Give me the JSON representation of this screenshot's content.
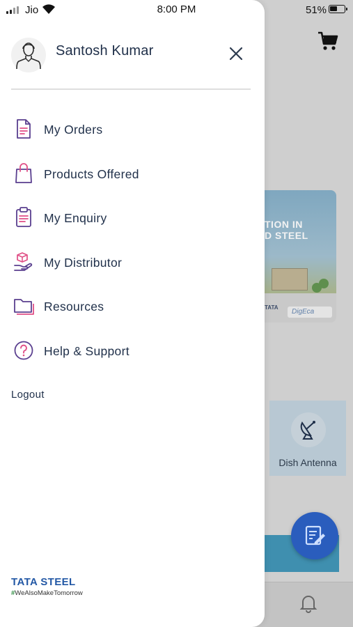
{
  "status_bar": {
    "carrier": "Jio",
    "time": "8:00 PM",
    "battery_percent": "51%",
    "battery_level": 0.51
  },
  "background": {
    "banner_lines": [
      "TION IN",
      "D STEEL"
    ],
    "banner_tata": "TATA",
    "banner_brand": "DigEca",
    "card_label": "Dish Antenna"
  },
  "drawer": {
    "user_name": "Santosh Kumar",
    "close_icon": "close-icon",
    "menu_items": [
      {
        "label": "My Orders",
        "icon": "document-icon"
      },
      {
        "label": "Products Offered",
        "icon": "shopping-bag-icon"
      },
      {
        "label": "My Enquiry",
        "icon": "clipboard-icon"
      },
      {
        "label": "My Distributor",
        "icon": "hand-package-icon"
      },
      {
        "label": "Resources",
        "icon": "folder-icon"
      },
      {
        "label": "Help & Support",
        "icon": "question-circle-icon"
      }
    ],
    "logout_label": "Logout",
    "brand": {
      "name": "TATA STEEL",
      "tagline_hash": "#",
      "tagline": "WeAlsoMakeTomorrow"
    }
  },
  "colors": {
    "text_primary": "#1f2f49",
    "icon_purple": "#5a3f8f",
    "icon_pink": "#e04f86",
    "brand_blue": "#2358a5",
    "fab_blue": "#2a5dbd"
  }
}
